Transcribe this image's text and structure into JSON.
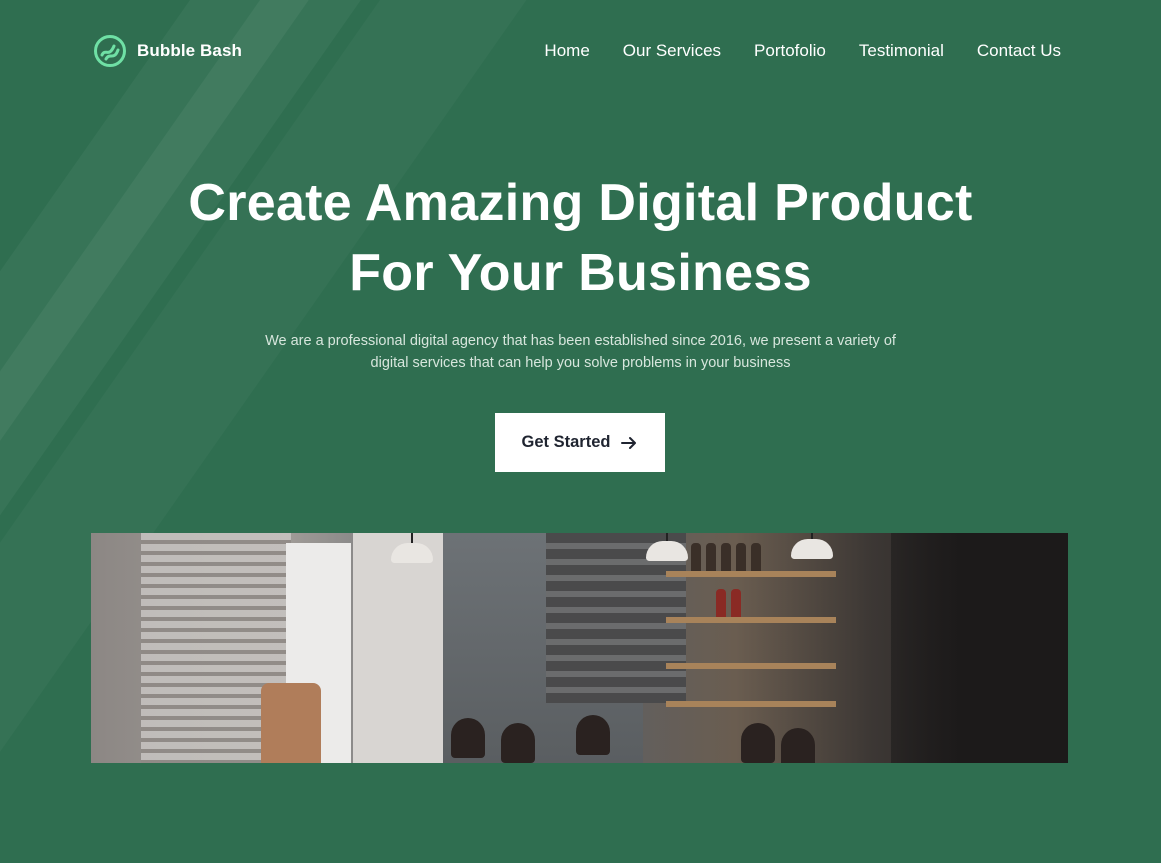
{
  "brand": {
    "name": "Bubble Bash",
    "logo_icon": "bubble-bash-logo-icon",
    "logo_color": "#6fe0a5"
  },
  "nav": {
    "items": [
      {
        "label": "Home"
      },
      {
        "label": "Our Services"
      },
      {
        "label": "Portofolio"
      },
      {
        "label": "Testimonial"
      },
      {
        "label": "Contact Us"
      }
    ]
  },
  "hero": {
    "title_line_1": "Create Amazing Digital Product",
    "title_line_2": "For Your Business",
    "subtitle_line_1": "We are a professional digital agency that has been established since 2016, we present a variety of",
    "subtitle_line_2": "digital services that can help you solve problems in your business",
    "cta_label": "Get Started",
    "cta_icon": "arrow-right-icon"
  },
  "colors": {
    "background": "#2f6e50",
    "accent": "#6fe0a5",
    "button_bg": "#ffffff",
    "button_text": "#1f2430",
    "subtitle_text": "#d7e6dd"
  }
}
